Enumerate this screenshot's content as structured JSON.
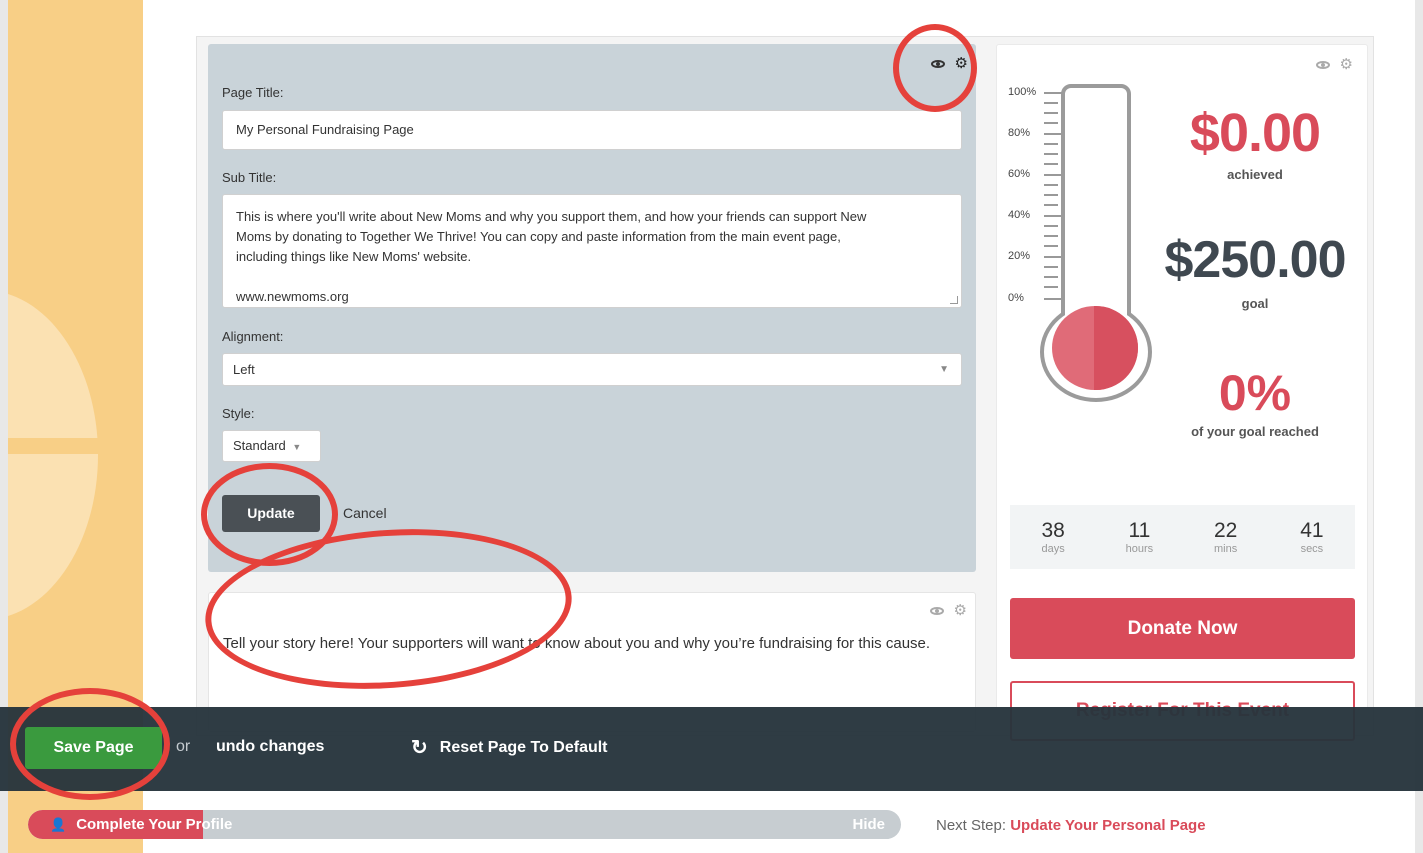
{
  "editor": {
    "page_title_label": "Page Title:",
    "page_title_value": "My Personal Fundraising Page",
    "sub_title_label": "Sub Title:",
    "sub_title_lines": [
      "This is where you'll write about New Moms and why you support them, and how your friends can support New",
      "Moms by donating to Together We Thrive! You can copy and paste information from the main event page,",
      "including things like New Moms' website.",
      "www.newmoms.org"
    ],
    "alignment_label": "Alignment:",
    "alignment_value": "Left",
    "style_label": "Style:",
    "style_value": "Standard",
    "update_label": "Update",
    "cancel_label": "Cancel"
  },
  "story": {
    "text": "Tell your story here! Your supporters will want to know about you and why you’re fundraising for this cause."
  },
  "thermometer": {
    "ticks": [
      "100%",
      "80%",
      "60%",
      "40%",
      "20%",
      "0%"
    ],
    "achieved_amount": "$0.00",
    "achieved_label": "achieved",
    "goal_amount": "$250.00",
    "goal_label": "goal",
    "percent": "0%",
    "percent_label": "of your goal reached"
  },
  "countdown": [
    {
      "value": "38",
      "unit": "days"
    },
    {
      "value": "11",
      "unit": "hours"
    },
    {
      "value": "22",
      "unit": "mins"
    },
    {
      "value": "41",
      "unit": "secs"
    }
  ],
  "sidebar": {
    "donate_label": "Donate Now",
    "register_label": "Register For This Event"
  },
  "toolbar": {
    "save_label": "Save Page",
    "or_text": "or",
    "undo_label": "undo changes",
    "reset_label": "Reset Page To Default"
  },
  "profile_progress": {
    "label": "Complete Your Profile",
    "hide_label": "Hide",
    "progress_fraction": 0.2,
    "next_step_prefix": "Next Step:",
    "next_step_link": "Update Your Personal Page"
  },
  "colors": {
    "accent_red": "#d94b5a",
    "save_green": "#3a9a3e",
    "toolbar_dark": "#26343c",
    "editor_bg": "#c9d3d9",
    "band_orange": "#f8cf86",
    "annotation_red": "#e5413b"
  },
  "icons": [
    "eye-icon",
    "gear-icon",
    "caret-down-icon",
    "reset-icon",
    "user-icon"
  ]
}
